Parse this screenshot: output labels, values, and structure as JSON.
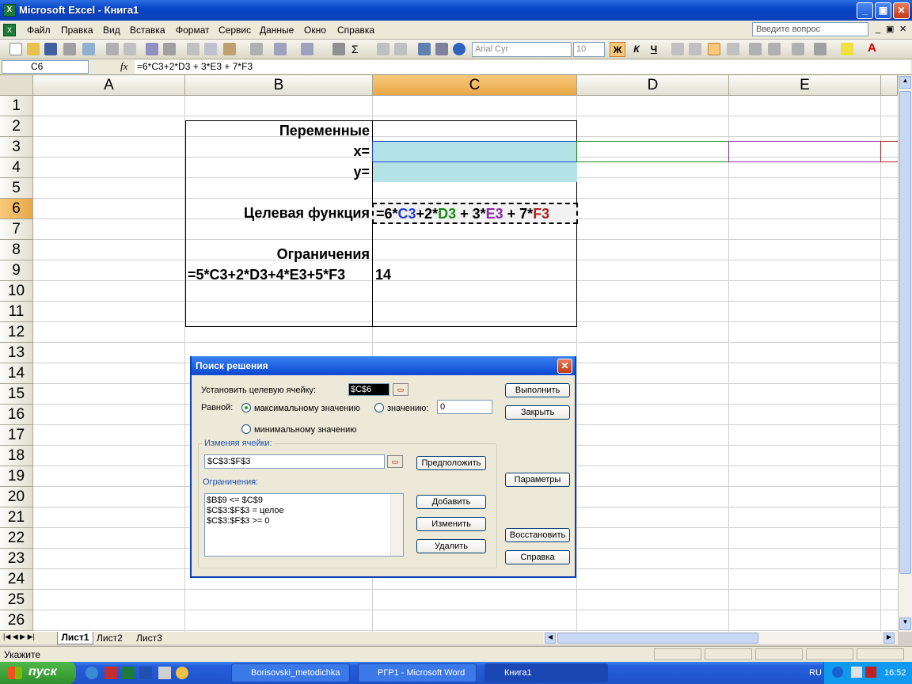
{
  "window": {
    "title": "Microsoft Excel - Книга1",
    "min_label": "_",
    "max_label": "▣",
    "close_label": "✕"
  },
  "menu": {
    "items": [
      "Файл",
      "Правка",
      "Вид",
      "Вставка",
      "Формат",
      "Сервис",
      "Данные",
      "Окно",
      "Справка"
    ],
    "ask_placeholder": "Введите вопрос"
  },
  "toolbar": {
    "font_name": "Arial Cyr",
    "font_size": "10",
    "bold": "Ж",
    "italic": "К",
    "underline": "Ч"
  },
  "formula_bar": {
    "name_box": "C6",
    "fx": "fx",
    "formula": "=6*C3+2*D3 + 3*E3 + 7*F3"
  },
  "sheet": {
    "columns": [
      "A",
      "B",
      "C",
      "D",
      "E"
    ],
    "selected_column": "C",
    "rows": [
      "1",
      "2",
      "3",
      "4",
      "5",
      "6",
      "7",
      "8",
      "9",
      "10",
      "11",
      "12",
      "13",
      "14",
      "15",
      "16",
      "17",
      "18",
      "19",
      "20",
      "21",
      "22",
      "23",
      "24",
      "25",
      "26"
    ],
    "selected_row": "6",
    "cells": {
      "B2": "Переменные",
      "B3": "x=",
      "B4": "y=",
      "B6": "Целевая функция",
      "C6": "=6*C3+2*D3 + 3*E3 + 7*F3",
      "B8": "Ограничения",
      "B9": "=5*C3+2*D3+4*E3+5*F3",
      "C9": "14"
    },
    "c6_parts": [
      {
        "text": "=6*",
        "color": "#000000"
      },
      {
        "text": "C3",
        "color": "#1f3fd0"
      },
      {
        "text": "+2*",
        "color": "#000000"
      },
      {
        "text": "D3",
        "color": "#1a8a1a"
      },
      {
        "text": " + 3*",
        "color": "#000000"
      },
      {
        "text": "E3",
        "color": "#8a2ab0"
      },
      {
        "text": " + 7*",
        "color": "#000000"
      },
      {
        "text": "F3",
        "color": "#b02020"
      }
    ],
    "tabs": [
      "Лист1",
      "Лист2",
      "Лист3"
    ],
    "active_tab": "Лист1"
  },
  "status": {
    "text": "Укажите"
  },
  "dialog": {
    "title": "Поиск решения",
    "target_label": "Установить целевую ячейку:",
    "target_value": "$C$6",
    "equal_label": "Равной:",
    "opt_max": "максимальному значению",
    "opt_value": "значению:",
    "value_field": "0",
    "opt_min": "минимальному значению",
    "changing_label": "Изменяя ячейки:",
    "changing_value": "$C$3:$F$3",
    "constraints_label": "Ограничения:",
    "constraints": [
      "$B$9 <= $C$9",
      "$C$3:$F$3 = целое",
      "$C$3:$F$3 >= 0"
    ],
    "btn_solve": "Выполнить",
    "btn_close": "Закрыть",
    "btn_guess": "Предположить",
    "btn_params": "Параметры",
    "btn_add": "Добавить",
    "btn_change": "Изменить",
    "btn_delete": "Удалить",
    "btn_reset": "Восстановить",
    "btn_help": "Справка"
  },
  "taskbar": {
    "start": "пуск",
    "items": [
      "Borisovski_metodichka",
      "РГР1 - Microsoft Word",
      "Книга1"
    ],
    "lang": "RU",
    "clock": "16:52"
  }
}
